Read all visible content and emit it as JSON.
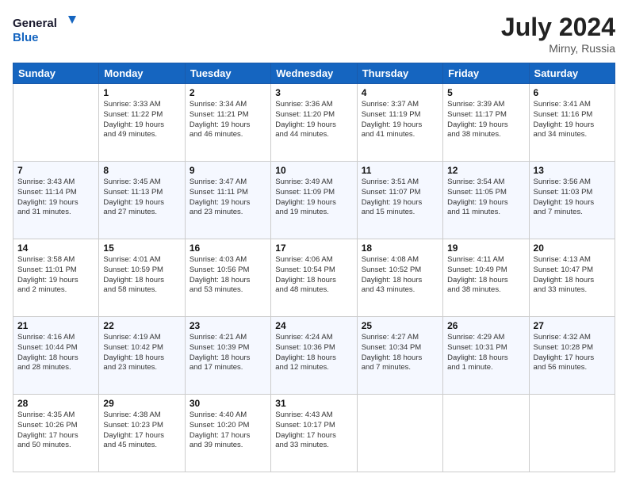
{
  "header": {
    "logo_line1": "General",
    "logo_line2": "Blue",
    "month_year": "July 2024",
    "location": "Mirny, Russia"
  },
  "days_of_week": [
    "Sunday",
    "Monday",
    "Tuesday",
    "Wednesday",
    "Thursday",
    "Friday",
    "Saturday"
  ],
  "weeks": [
    [
      {
        "num": "",
        "info": ""
      },
      {
        "num": "1",
        "info": "Sunrise: 3:33 AM\nSunset: 11:22 PM\nDaylight: 19 hours\nand 49 minutes."
      },
      {
        "num": "2",
        "info": "Sunrise: 3:34 AM\nSunset: 11:21 PM\nDaylight: 19 hours\nand 46 minutes."
      },
      {
        "num": "3",
        "info": "Sunrise: 3:36 AM\nSunset: 11:20 PM\nDaylight: 19 hours\nand 44 minutes."
      },
      {
        "num": "4",
        "info": "Sunrise: 3:37 AM\nSunset: 11:19 PM\nDaylight: 19 hours\nand 41 minutes."
      },
      {
        "num": "5",
        "info": "Sunrise: 3:39 AM\nSunset: 11:17 PM\nDaylight: 19 hours\nand 38 minutes."
      },
      {
        "num": "6",
        "info": "Sunrise: 3:41 AM\nSunset: 11:16 PM\nDaylight: 19 hours\nand 34 minutes."
      }
    ],
    [
      {
        "num": "7",
        "info": "Sunrise: 3:43 AM\nSunset: 11:14 PM\nDaylight: 19 hours\nand 31 minutes."
      },
      {
        "num": "8",
        "info": "Sunrise: 3:45 AM\nSunset: 11:13 PM\nDaylight: 19 hours\nand 27 minutes."
      },
      {
        "num": "9",
        "info": "Sunrise: 3:47 AM\nSunset: 11:11 PM\nDaylight: 19 hours\nand 23 minutes."
      },
      {
        "num": "10",
        "info": "Sunrise: 3:49 AM\nSunset: 11:09 PM\nDaylight: 19 hours\nand 19 minutes."
      },
      {
        "num": "11",
        "info": "Sunrise: 3:51 AM\nSunset: 11:07 PM\nDaylight: 19 hours\nand 15 minutes."
      },
      {
        "num": "12",
        "info": "Sunrise: 3:54 AM\nSunset: 11:05 PM\nDaylight: 19 hours\nand 11 minutes."
      },
      {
        "num": "13",
        "info": "Sunrise: 3:56 AM\nSunset: 11:03 PM\nDaylight: 19 hours\nand 7 minutes."
      }
    ],
    [
      {
        "num": "14",
        "info": "Sunrise: 3:58 AM\nSunset: 11:01 PM\nDaylight: 19 hours\nand 2 minutes."
      },
      {
        "num": "15",
        "info": "Sunrise: 4:01 AM\nSunset: 10:59 PM\nDaylight: 18 hours\nand 58 minutes."
      },
      {
        "num": "16",
        "info": "Sunrise: 4:03 AM\nSunset: 10:56 PM\nDaylight: 18 hours\nand 53 minutes."
      },
      {
        "num": "17",
        "info": "Sunrise: 4:06 AM\nSunset: 10:54 PM\nDaylight: 18 hours\nand 48 minutes."
      },
      {
        "num": "18",
        "info": "Sunrise: 4:08 AM\nSunset: 10:52 PM\nDaylight: 18 hours\nand 43 minutes."
      },
      {
        "num": "19",
        "info": "Sunrise: 4:11 AM\nSunset: 10:49 PM\nDaylight: 18 hours\nand 38 minutes."
      },
      {
        "num": "20",
        "info": "Sunrise: 4:13 AM\nSunset: 10:47 PM\nDaylight: 18 hours\nand 33 minutes."
      }
    ],
    [
      {
        "num": "21",
        "info": "Sunrise: 4:16 AM\nSunset: 10:44 PM\nDaylight: 18 hours\nand 28 minutes."
      },
      {
        "num": "22",
        "info": "Sunrise: 4:19 AM\nSunset: 10:42 PM\nDaylight: 18 hours\nand 23 minutes."
      },
      {
        "num": "23",
        "info": "Sunrise: 4:21 AM\nSunset: 10:39 PM\nDaylight: 18 hours\nand 17 minutes."
      },
      {
        "num": "24",
        "info": "Sunrise: 4:24 AM\nSunset: 10:36 PM\nDaylight: 18 hours\nand 12 minutes."
      },
      {
        "num": "25",
        "info": "Sunrise: 4:27 AM\nSunset: 10:34 PM\nDaylight: 18 hours\nand 7 minutes."
      },
      {
        "num": "26",
        "info": "Sunrise: 4:29 AM\nSunset: 10:31 PM\nDaylight: 18 hours\nand 1 minute."
      },
      {
        "num": "27",
        "info": "Sunrise: 4:32 AM\nSunset: 10:28 PM\nDaylight: 17 hours\nand 56 minutes."
      }
    ],
    [
      {
        "num": "28",
        "info": "Sunrise: 4:35 AM\nSunset: 10:26 PM\nDaylight: 17 hours\nand 50 minutes."
      },
      {
        "num": "29",
        "info": "Sunrise: 4:38 AM\nSunset: 10:23 PM\nDaylight: 17 hours\nand 45 minutes."
      },
      {
        "num": "30",
        "info": "Sunrise: 4:40 AM\nSunset: 10:20 PM\nDaylight: 17 hours\nand 39 minutes."
      },
      {
        "num": "31",
        "info": "Sunrise: 4:43 AM\nSunset: 10:17 PM\nDaylight: 17 hours\nand 33 minutes."
      },
      {
        "num": "",
        "info": ""
      },
      {
        "num": "",
        "info": ""
      },
      {
        "num": "",
        "info": ""
      }
    ]
  ]
}
